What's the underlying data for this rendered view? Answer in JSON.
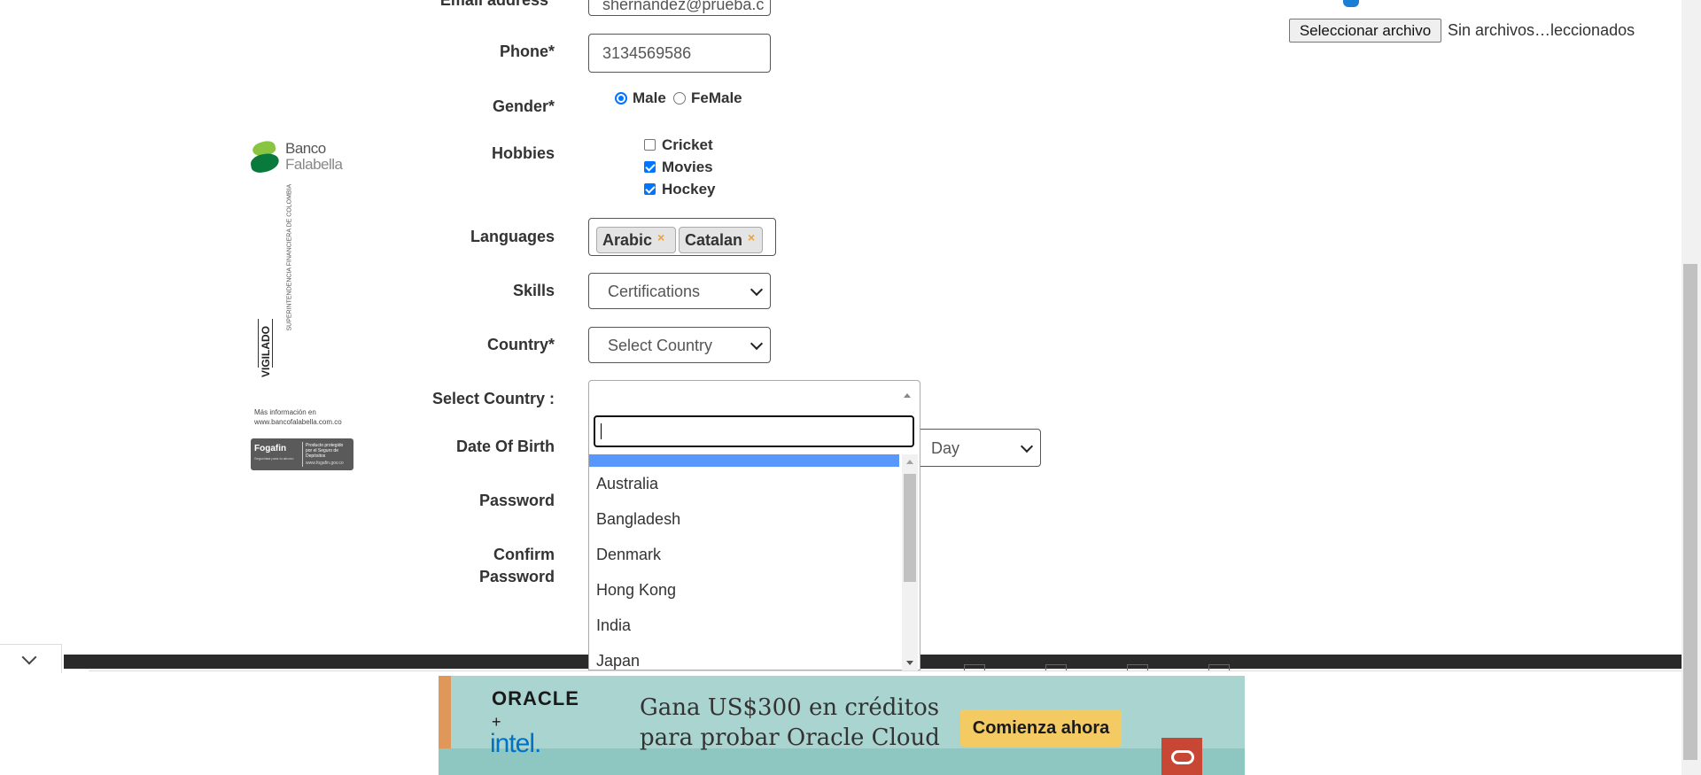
{
  "form": {
    "email": {
      "label": "Email address*",
      "value": "shernandez@prueba.c"
    },
    "phone": {
      "label": "Phone*",
      "value": "3134569586"
    },
    "gender": {
      "label": "Gender*",
      "options": [
        "Male",
        "FeMale"
      ],
      "selected": "Male"
    },
    "hobbies": {
      "label": "Hobbies",
      "items": [
        {
          "label": "Cricket",
          "checked": false
        },
        {
          "label": "Movies",
          "checked": true
        },
        {
          "label": "Hockey",
          "checked": true
        }
      ]
    },
    "languages": {
      "label": "Languages",
      "tags": [
        "Arabic",
        "Catalan"
      ]
    },
    "skills": {
      "label": "Skills",
      "value": "Certifications"
    },
    "country": {
      "label": "Country*",
      "value": "Select Country"
    },
    "select_country": {
      "label": "Select Country :"
    },
    "dob": {
      "label": "Date Of Birth",
      "day_value": "Day"
    },
    "password": {
      "label": "Password"
    },
    "confirm_password": {
      "label_line1": "Confirm",
      "label_line2": "Password"
    }
  },
  "file_upload": {
    "button": "Seleccionar archivo",
    "status": "Sin archivos…leccionados"
  },
  "country_dropdown": {
    "search_value": "",
    "options": [
      "Australia",
      "Bangladesh",
      "Denmark",
      "Hong Kong",
      "India",
      "Japan"
    ]
  },
  "sidebar_ad": {
    "logo_line1": "Banco",
    "logo_line2": "Falabella",
    "vigilado": "VIGILADO",
    "superintendencia": "SUPERINTENDENCIA FINANCIERA DE COLOMBIA",
    "more_info_line1": "Más información en",
    "more_info_line2": "www.bancofalabella.com.co",
    "fogafin": "Fogafin",
    "fogafin_sub": "Producto protegido por el Seguro de Depósitos",
    "fogafin_tag": "Seguridad para tu ahorro",
    "fogafin_url": "www.fogafin.gov.co"
  },
  "banner_ad": {
    "brand1": "ORACLE",
    "plus": "+",
    "brand2": "intel.",
    "headline_line1": "Gana US$300 en créditos",
    "headline_line2": "para probar Oracle Cloud",
    "cta": "Comienza ahora",
    "colors": {
      "bg": "#a9d4d0",
      "cta_bg": "#f4cb62",
      "logo_red": "#c74634",
      "intel_blue": "#0071c5"
    }
  },
  "colors": {
    "accent": "#0075ff",
    "highlight": "#5897fb",
    "dark_bar": "#2a2a2a"
  }
}
